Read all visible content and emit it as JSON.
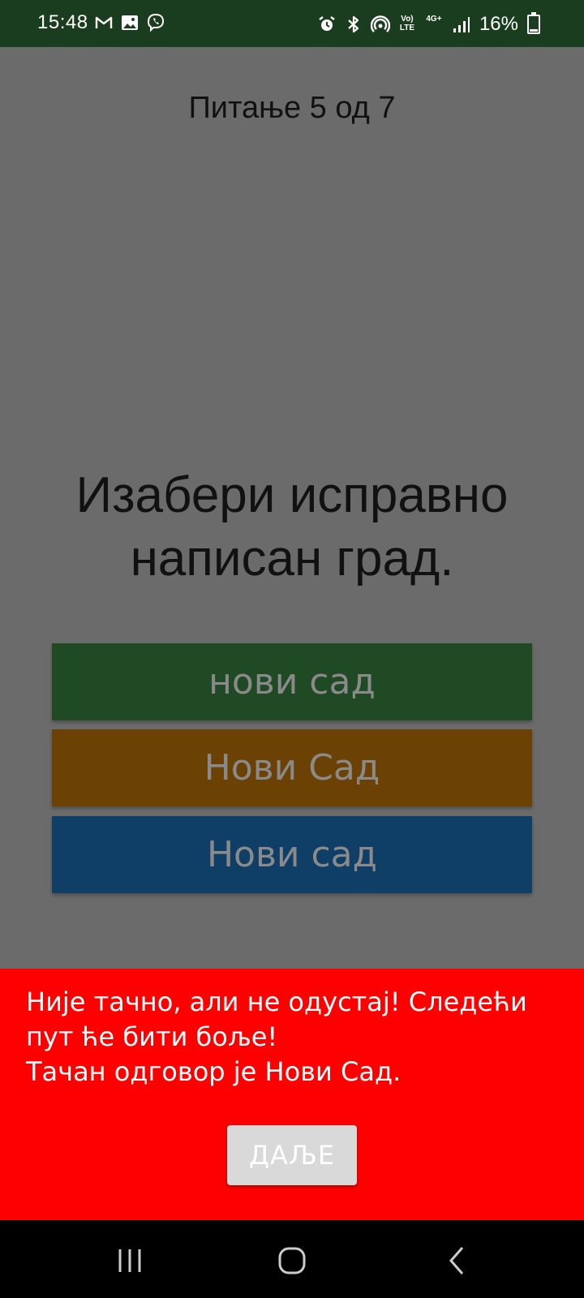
{
  "status_bar": {
    "time": "15:48",
    "left_icons": [
      "gmail-icon",
      "gallery-icon",
      "viber-icon"
    ],
    "right_icons": [
      "alarm-icon",
      "bluetooth-icon",
      "hotspot-icon",
      "volte-icon",
      "4g-icon",
      "signal-icon"
    ],
    "volte_label": "Vo) LTE",
    "network_label": "4G+",
    "battery_percent": "16%",
    "battery_level": 0.16
  },
  "quiz": {
    "progress_text": "Питање 5 од 7",
    "question": "Изабери исправно написан град.",
    "answers": [
      {
        "label": "нови сад",
        "color": "#1f4a23"
      },
      {
        "label": "Нови Сад",
        "color": "#6b4104"
      },
      {
        "label": "Нови сад",
        "color": "#0f3f66"
      }
    ]
  },
  "feedback": {
    "message": "Није тачно, али не одустај! Следећи пут ће бити боље!\n Тачан одговор је Нови Сад.",
    "next_label": "ДАЉЕ",
    "background": "#ff0000"
  },
  "nav_bar": {
    "icons": [
      "recents-icon",
      "home-icon",
      "back-icon"
    ]
  }
}
